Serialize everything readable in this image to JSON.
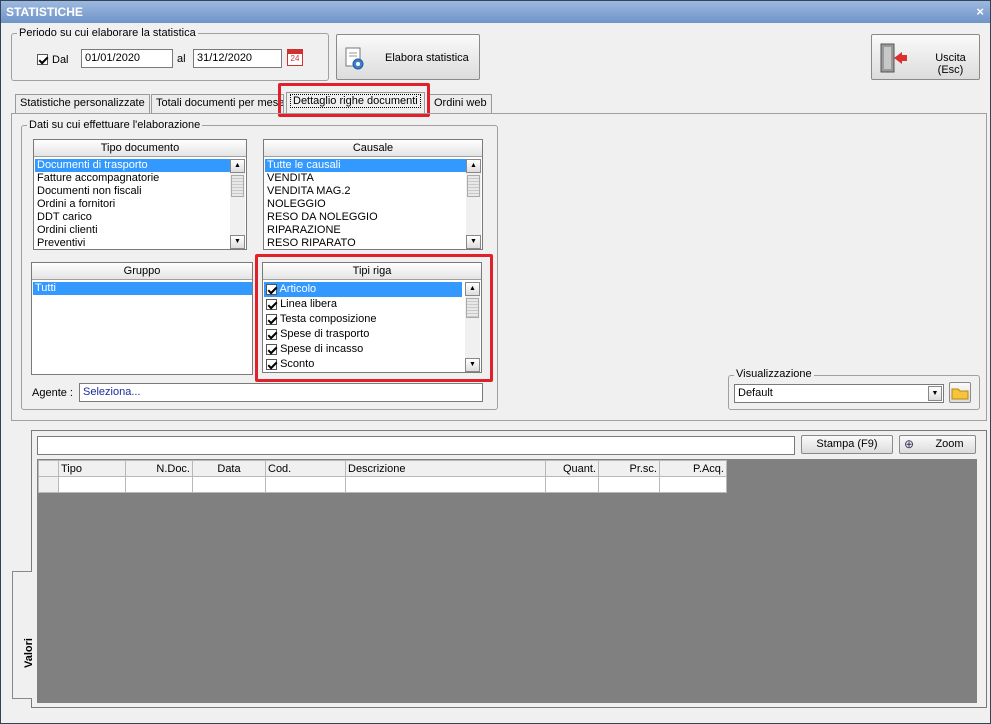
{
  "window": {
    "title": "STATISTICHE",
    "close": "×"
  },
  "period": {
    "legend": "Periodo su cui elaborare la statistica",
    "dal_label": "Dal",
    "dal_checked": true,
    "from": "01/01/2020",
    "al_label": "al",
    "to": "31/12/2020",
    "calendar_day": "24"
  },
  "buttons": {
    "elabora": "Elabora statistica",
    "uscita": "Uscita (Esc)",
    "stampa": "Stampa (F9)",
    "zoom": "Zoom"
  },
  "tabs": [
    "Statistiche personalizzate",
    "Totali documenti per mese",
    "Dettaglio righe documenti",
    "Ordini web"
  ],
  "active_tab": 2,
  "dati_legend": "Dati su cui effettuare l'elaborazione",
  "tipo_documento": {
    "header": "Tipo documento",
    "items": [
      "Documenti di trasporto",
      "Fatture accompagnatorie",
      "Documenti non fiscali",
      "Ordini a fornitori",
      "DDT carico",
      "Ordini clienti",
      "Preventivi"
    ],
    "selected": 0
  },
  "causale": {
    "header": "Causale",
    "items": [
      "Tutte le causali",
      "VENDITA",
      "VENDITA MAG.2",
      "NOLEGGIO",
      "RESO DA NOLEGGIO",
      "RIPARAZIONE",
      "RESO RIPARATO"
    ],
    "selected": 0
  },
  "gruppo": {
    "header": "Gruppo",
    "items": [
      "Tutti"
    ],
    "selected": 0
  },
  "tipi_riga": {
    "header": "Tipi riga",
    "items": [
      "Articolo",
      "Linea libera",
      "Testa composizione",
      "Spese di trasporto",
      "Spese di incasso",
      "Sconto"
    ],
    "selected": 0
  },
  "agente": {
    "label": "Agente :",
    "value": "Seleziona..."
  },
  "visualizzazione": {
    "legend": "Visualizzazione",
    "value": "Default"
  },
  "grid": {
    "columns": [
      "",
      "Tipo",
      "N.Doc.",
      "Data",
      "Cod.",
      "Descrizione",
      "Quant.",
      "Pr.sc.",
      "P.Acq."
    ]
  },
  "side_tab": "Valori",
  "colors": {
    "highlight": "#e0202a",
    "selection": "#3399ff",
    "grid_bg": "#808080"
  }
}
